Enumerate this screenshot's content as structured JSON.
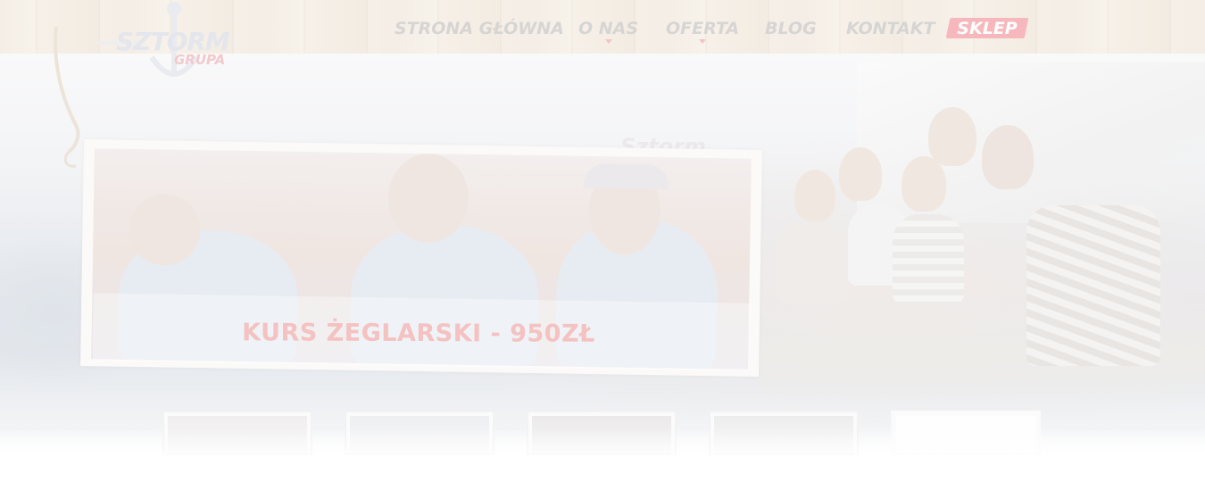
{
  "logo": {
    "main_text": "SZTORM",
    "sub_text": "GRUPA",
    "icon": "anchor-icon"
  },
  "nav": {
    "items": [
      {
        "label": "STRONA GŁÓWNA",
        "has_dropdown": false
      },
      {
        "label": "O NAS",
        "has_dropdown": true
      },
      {
        "label": "OFERTA",
        "has_dropdown": true
      },
      {
        "label": "BLOG",
        "has_dropdown": false
      },
      {
        "label": "KONTAKT",
        "has_dropdown": false
      }
    ],
    "shop_label": "SKLEP"
  },
  "slider": {
    "caption": "KURS ŻEGLARSKI - 950ZŁ",
    "watermark": "Sztorm"
  },
  "thumbnails": {
    "count": 5
  },
  "colors": {
    "accent": "#f6b8bd",
    "nav_text": "#d7d5d3",
    "caption_text": "#f4c2c1"
  }
}
